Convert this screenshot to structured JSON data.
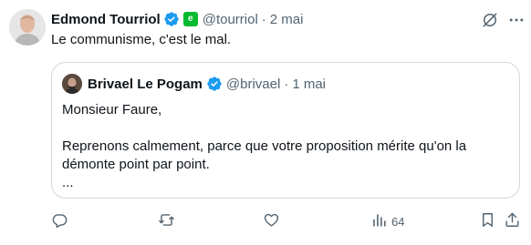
{
  "tweet": {
    "author_name": "Edmond Tourriol",
    "handle": "@tourriol",
    "separator": "·",
    "date": "2 mai",
    "text": "Le communisme, c'est le mal.",
    "affiliate_badge": "e"
  },
  "quoted": {
    "author_name": "Brivael Le Pogam",
    "handle": "@brivael",
    "separator": "·",
    "date": "1 mai",
    "line1": "Monsieur Faure,",
    "line2": "Reprenons calmement, parce que votre proposition mérite qu'on la démonte point par point.",
    "line3": "..."
  },
  "actions": {
    "views": "64",
    "reply_icon": "reply-icon",
    "retweet_icon": "retweet-icon",
    "like_icon": "like-icon",
    "views_icon": "views-icon",
    "bookmark_icon": "bookmark-icon",
    "share_icon": "share-icon"
  },
  "colors": {
    "verified": "#1d9bf0",
    "affiliate": "#00ba2f",
    "secondary_text": "#536471",
    "border": "#cfd9de"
  }
}
